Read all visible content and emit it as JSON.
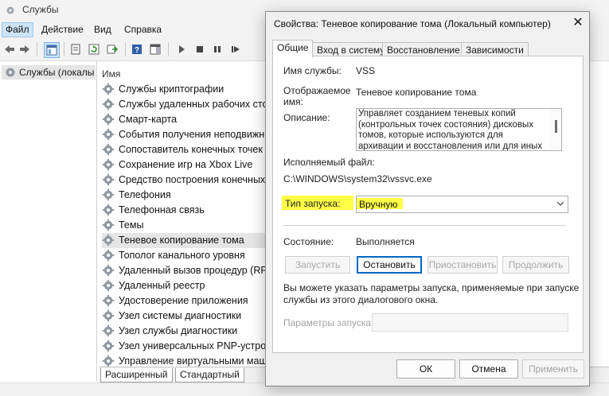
{
  "window": {
    "title": "Службы"
  },
  "menu": [
    {
      "label": "Файл",
      "active": true
    },
    {
      "label": "Действие",
      "active": false
    },
    {
      "label": "Вид",
      "active": false
    },
    {
      "label": "Справка",
      "active": false
    }
  ],
  "toolbar": {
    "icons": [
      "back-arrow-icon",
      "forward-arrow-icon",
      "console-tree-icon",
      "properties-icon",
      "refresh-icon",
      "export-icon",
      "help-icon",
      "show-pane-icon",
      "play-icon",
      "stop-icon",
      "pause-icon",
      "restart-icon"
    ]
  },
  "tree": {
    "root_label": "Службы (локалы"
  },
  "list": {
    "column_name": "Имя",
    "rows": [
      "Службы криптографии",
      "Службы удаленных рабочих столо",
      "Смарт-карта",
      "События получения неподвижных",
      "Сопоставитель конечных точек RF",
      "Сохранение игр на Xbox Live",
      "Средство построения конечных то",
      "Телефония",
      "Телефонная связь",
      "Темы",
      "Теневое копирование тома",
      "Тополог канального уровня",
      "Удаленный вызов процедур (RPC)",
      "Удаленный реестр",
      "Удостоверение приложения",
      "Узел системы диагностики",
      "Узел службы диагностики",
      "Узел универсальных PNP-устройс",
      "Управление виртуальными машин"
    ],
    "selected_index": 10
  },
  "bottom_tabs": [
    "Расширенный",
    "Стандартный"
  ],
  "dialog": {
    "title": "Свойства: Теневое копирование тома (Локальный компьютер)",
    "close_glyph": "✕",
    "tabs": [
      "Общие",
      "Вход в систему",
      "Восстановление",
      "Зависимости"
    ],
    "labels": {
      "service_name": "Имя службы:",
      "display_name_1": "Отображаемое",
      "display_name_2": "имя:",
      "description": "Описание:",
      "exe_path": "Исполняемый файл:",
      "startup_type": "Тип запуска:",
      "status": "Состояние:",
      "start_params": "Параметры запуска:"
    },
    "values": {
      "service_name": "VSS",
      "display_name": "Теневое копирование тома",
      "description": "Управляет созданием теневых копий (контрольных точек состояния) дисковых томов, которые используются для архивации и восстановления или для иных целей. Если эта",
      "exe_path": "C:\\WINDOWS\\system32\\vssvc.exe",
      "startup_type": "Вручную",
      "status": "Выполняется"
    },
    "buttons": {
      "start": "Запустить",
      "stop": "Остановить",
      "pause": "Приостановить",
      "resume": "Продолжить"
    },
    "hint": "Вы можете указать параметры запуска, применяемые при запуске службы из этого диалогового окна.",
    "hint_line1": "Вы можете указать параметры запуска, применяемые при запуске",
    "hint_line2": "службы из этого диалогового окна.",
    "footer": {
      "ok": "ОК",
      "cancel": "Отмена",
      "apply": "Применить"
    }
  },
  "colors": {
    "highlight": "#ffff45",
    "selection": "#e5e5e5",
    "accent": "#0067c0"
  }
}
